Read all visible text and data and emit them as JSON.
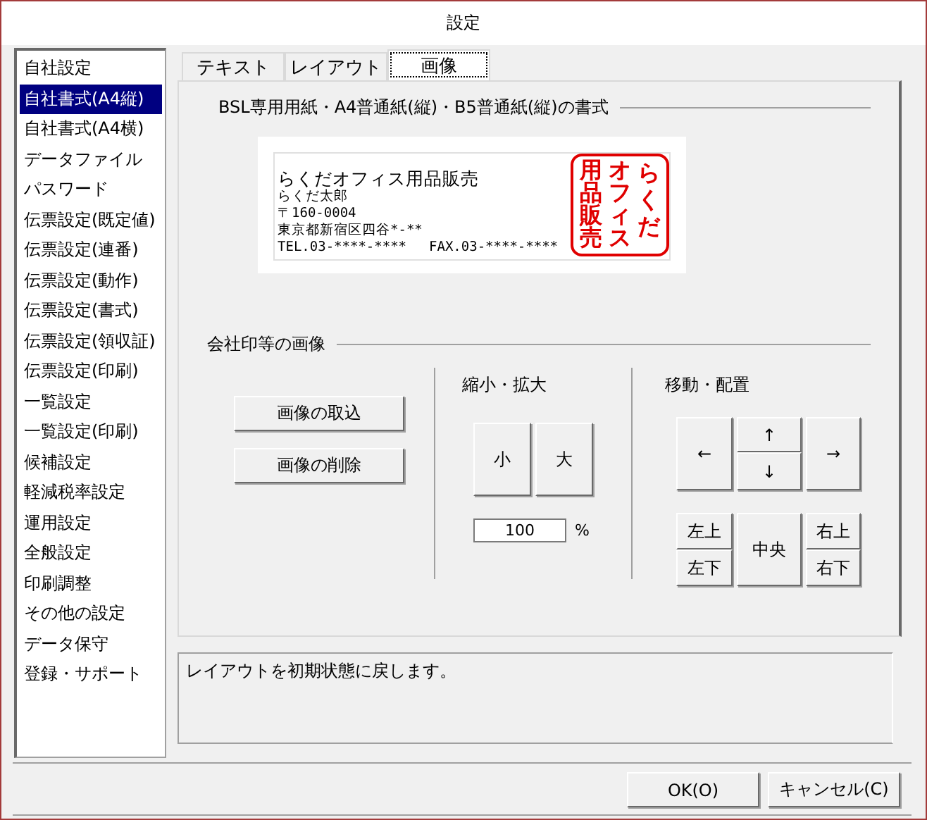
{
  "window": {
    "title": "設定"
  },
  "sidebar": {
    "items": [
      {
        "label": "自社設定",
        "selected": false
      },
      {
        "label": "自社書式(A4縦)",
        "selected": true
      },
      {
        "label": "自社書式(A4横)",
        "selected": false
      },
      {
        "label": "データファイル",
        "selected": false
      },
      {
        "label": "パスワード",
        "selected": false
      },
      {
        "label": "伝票設定(既定値)",
        "selected": false
      },
      {
        "label": "伝票設定(連番)",
        "selected": false
      },
      {
        "label": "伝票設定(動作)",
        "selected": false
      },
      {
        "label": "伝票設定(書式)",
        "selected": false
      },
      {
        "label": "伝票設定(領収証)",
        "selected": false
      },
      {
        "label": "伝票設定(印刷)",
        "selected": false
      },
      {
        "label": "一覧設定",
        "selected": false
      },
      {
        "label": "一覧設定(印刷)",
        "selected": false
      },
      {
        "label": "候補設定",
        "selected": false
      },
      {
        "label": "軽減税率設定",
        "selected": false
      },
      {
        "label": "運用設定",
        "selected": false
      },
      {
        "label": "全般設定",
        "selected": false
      },
      {
        "label": "印刷調整",
        "selected": false
      },
      {
        "label": "その他の設定",
        "selected": false
      },
      {
        "label": "データ保守",
        "selected": false
      },
      {
        "label": "登録・サポート",
        "selected": false
      }
    ]
  },
  "tabs": [
    {
      "label": "テキスト",
      "selected": false
    },
    {
      "label": "レイアウト",
      "selected": false
    },
    {
      "label": "画像",
      "selected": true
    }
  ],
  "format_section": {
    "title": "BSL専用用紙・A4普通紙(縦)・B5普通紙(縦)の書式",
    "preview": {
      "company": "らくだオフィス用品販売",
      "name": "らくだ太郎",
      "postal": "〒160-0004",
      "address": "東京都新宿区四谷*-**",
      "tel": "TEL.03-****-****",
      "fax": "FAX.03-****-****",
      "stamp_columns": [
        "用品販売",
        "オフィス",
        "らくだ"
      ]
    }
  },
  "image_section": {
    "title": "会社印等の画像",
    "buttons": [
      "画像の取込",
      "画像の削除"
    ],
    "scale": {
      "title": "縮小・拡大",
      "buttons": [
        "小",
        "大"
      ],
      "value": "100",
      "unit": "%"
    },
    "move": {
      "title": "移動・配置",
      "left": "←",
      "up": "↑",
      "down": "↓",
      "right": "→",
      "top_left": "左上",
      "bottom_left": "左下",
      "center": "中央",
      "top_right": "右上",
      "bottom_right": "右下"
    }
  },
  "description": "レイアウトを初期状態に戻します。",
  "buttons": [
    "OK(O)",
    "キャンセル(C)"
  ]
}
